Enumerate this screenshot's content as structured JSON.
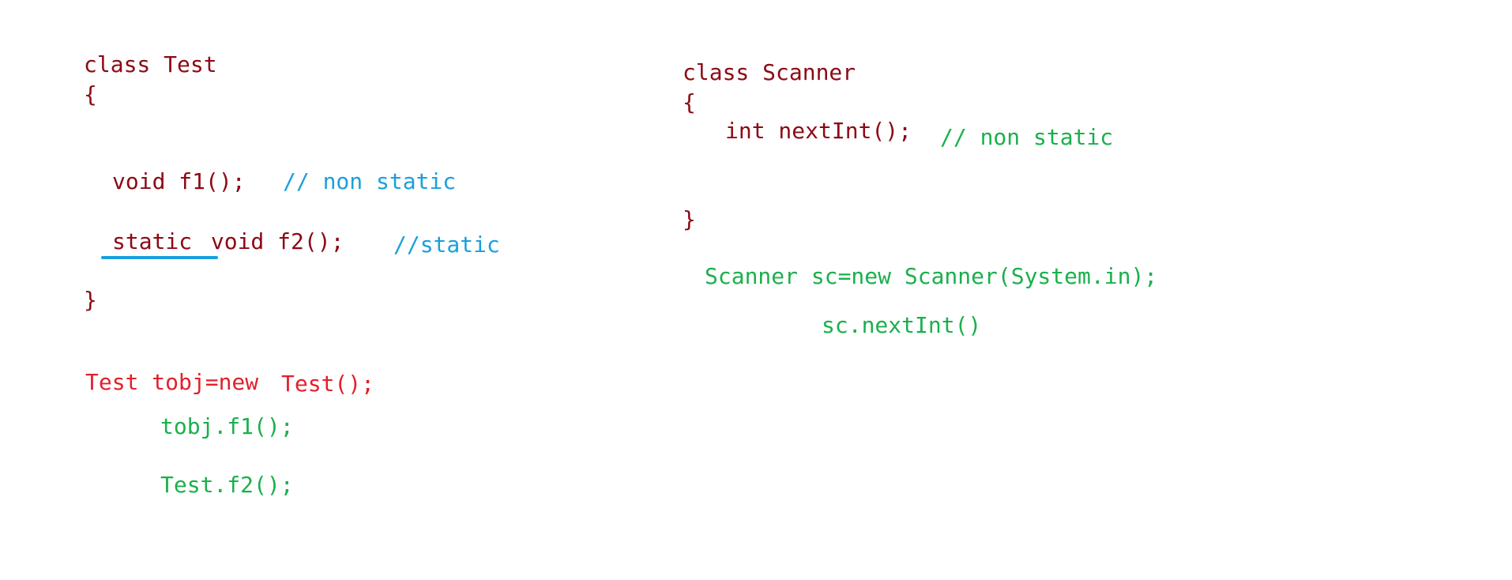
{
  "left": {
    "class_header": "class Test",
    "open_brace": "{",
    "f1_decl": "void f1();",
    "f1_comment": "// non static",
    "f2_static_kw": "static",
    "f2_decl": " void f2();",
    "f2_comment": "//static",
    "close_brace": "}",
    "obj_create_a": "Test tobj=new",
    "obj_create_b": "Test();",
    "call_f1": "tobj.f1();",
    "call_f2": "Test.f2();"
  },
  "right": {
    "class_header": "class Scanner",
    "open_brace": "{",
    "method_decl": "int nextInt();",
    "method_comment": "// non static",
    "close_brace": "}",
    "obj_create": "Scanner sc=new Scanner(System.in);",
    "call_next": "sc.nextInt()"
  },
  "colors": {
    "code": "#8b0a14",
    "comment_blue": "#1aa0dc",
    "instantiation_red": "#e3202b",
    "usage_green": "#1ab04c",
    "underline": "#1aa0dc"
  }
}
